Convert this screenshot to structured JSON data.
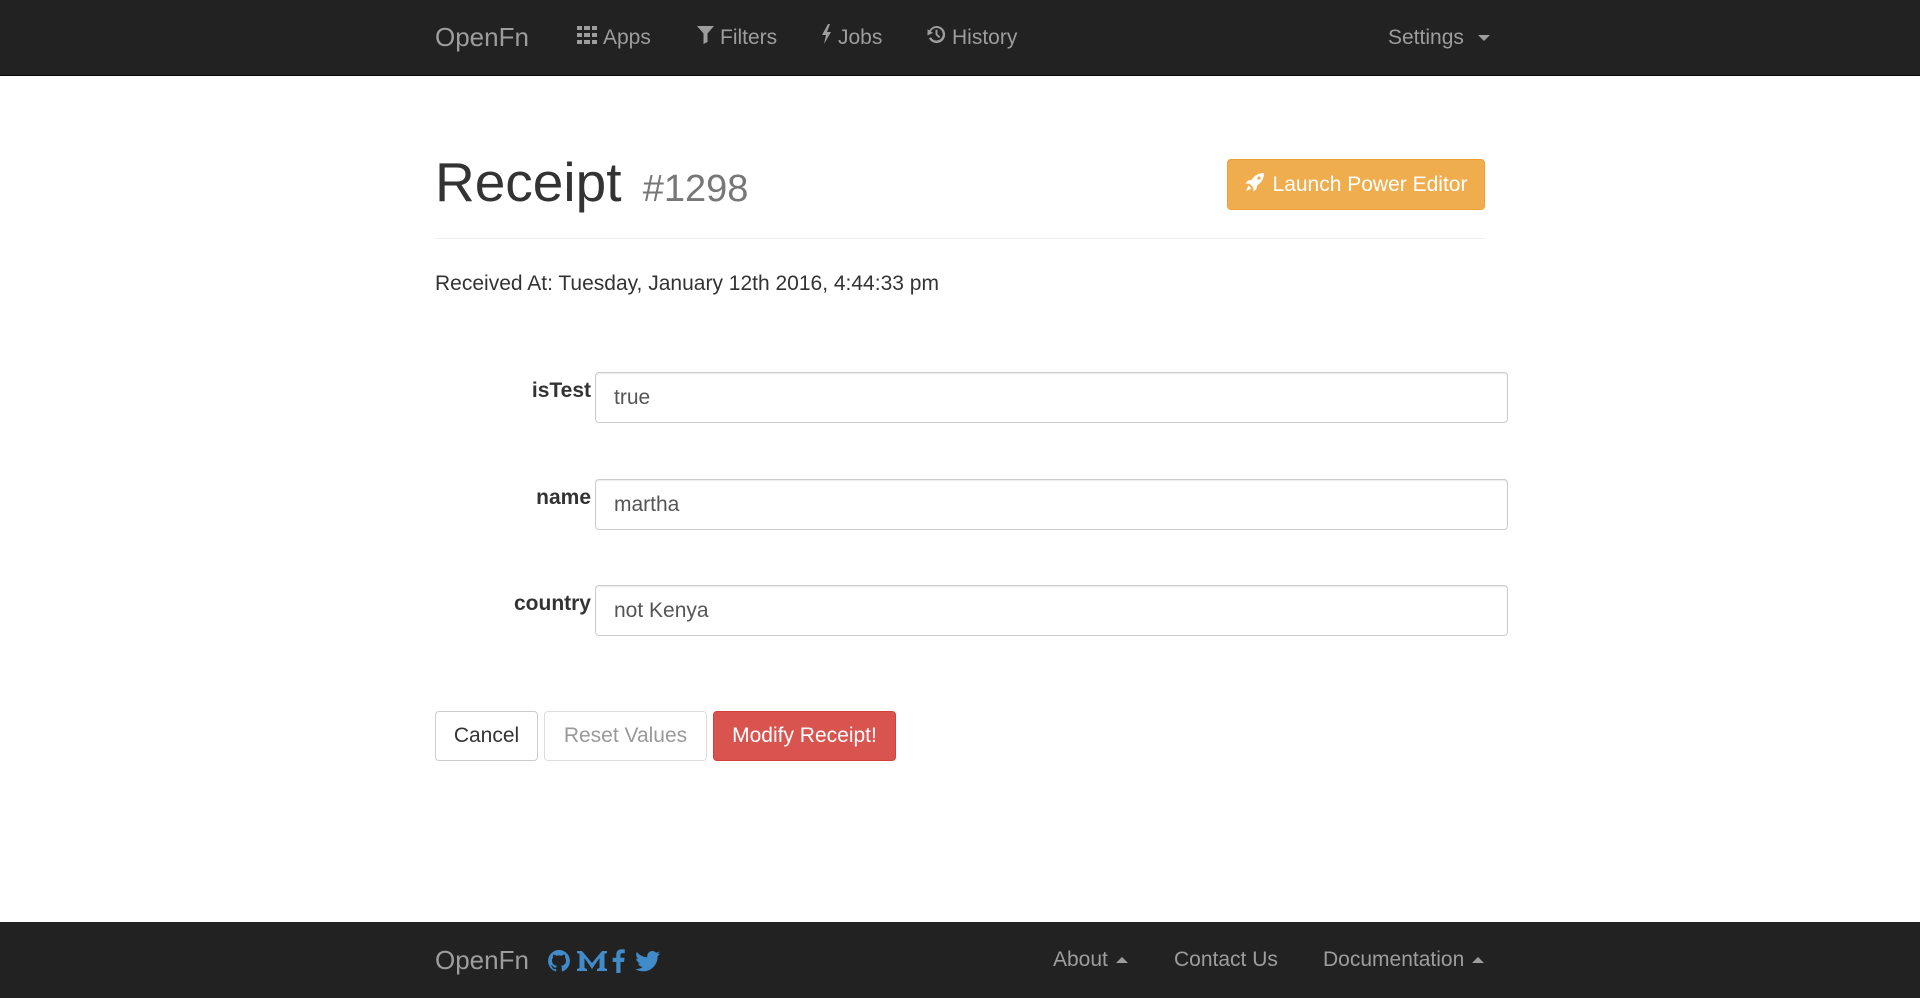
{
  "navbar": {
    "brand": "OpenFn",
    "items": [
      {
        "label": "Apps",
        "icon": "grid-icon"
      },
      {
        "label": "Filters",
        "icon": "filter-icon"
      },
      {
        "label": "Jobs",
        "icon": "bolt-icon"
      },
      {
        "label": "History",
        "icon": "history-icon"
      }
    ],
    "settings_label": "Settings"
  },
  "header": {
    "title": "Receipt",
    "id": "#1298",
    "power_editor_label": "Launch Power Editor"
  },
  "received_at": "Received At: Tuesday, January 12th 2016, 4:44:33 pm",
  "fields": [
    {
      "label": "isTest",
      "value": "true"
    },
    {
      "label": "name",
      "value": "martha"
    },
    {
      "label": "country",
      "value": "not Kenya"
    }
  ],
  "actions": {
    "cancel": "Cancel",
    "reset": "Reset Values",
    "modify": "Modify Receipt!"
  },
  "footer": {
    "brand": "OpenFn",
    "social_icons": [
      "github-icon",
      "medium-icon",
      "facebook-icon",
      "twitter-icon"
    ],
    "links": {
      "about": "About",
      "contact": "Contact Us",
      "documentation": "Documentation"
    }
  },
  "colors": {
    "navbar_bg": "#222222",
    "warning": "#f0ad4e",
    "danger": "#d9534f",
    "social": "#428bca"
  }
}
